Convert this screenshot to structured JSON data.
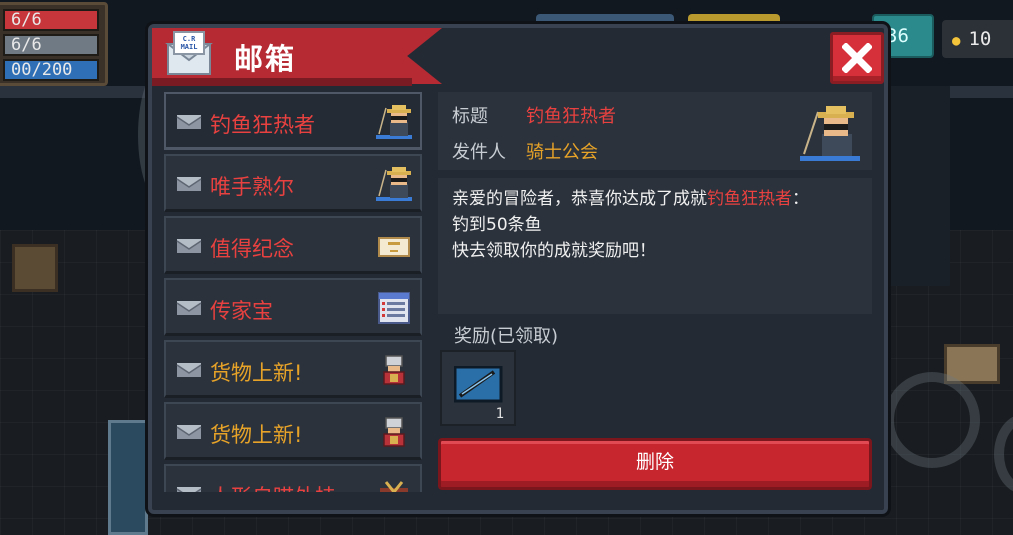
{
  "hud": {
    "hp": "6/6",
    "armor": "6/6",
    "energy": "00/200",
    "gems": "36",
    "coins": "10"
  },
  "window": {
    "title": "邮箱",
    "mail_icon_text": "C.R MAIL"
  },
  "mail_list": [
    {
      "label": "钓鱼狂热者",
      "color": "red",
      "icon": "fisherman-icon"
    },
    {
      "label": "唯手熟尔",
      "color": "red",
      "icon": "fisherman-icon"
    },
    {
      "label": "值得纪念",
      "color": "red",
      "icon": "certificate-icon"
    },
    {
      "label": "传家宝",
      "color": "red",
      "icon": "ledger-icon"
    },
    {
      "label": "货物上新!",
      "color": "orange",
      "icon": "merchant-icon"
    },
    {
      "label": "货物上新!",
      "color": "orange",
      "icon": "merchant-icon"
    },
    {
      "label": "人形自瞄外挂",
      "color": "red",
      "icon": "crosshair-icon"
    }
  ],
  "detail": {
    "subject_label": "标题",
    "subject_value": "钓鱼狂热者",
    "sender_label": "发件人",
    "sender_value": "骑士公会",
    "body_prefix": "亲爱的冒险者，恭喜你达成了成就",
    "body_highlight": "钓鱼狂热者",
    "body_colon": "：",
    "body_line2": "钓到50条鱼",
    "body_line3": "快去领取你的成就奖励吧！",
    "reward_label": "奖励(已领取)",
    "reward_count": "1",
    "reward_icon": "fishing-rod-icon",
    "delete_label": "删除"
  },
  "colors": {
    "accent_red": "#e8413f",
    "accent_orange": "#e7a328",
    "ribbon": "#b52a33",
    "panel": "#232a34"
  }
}
